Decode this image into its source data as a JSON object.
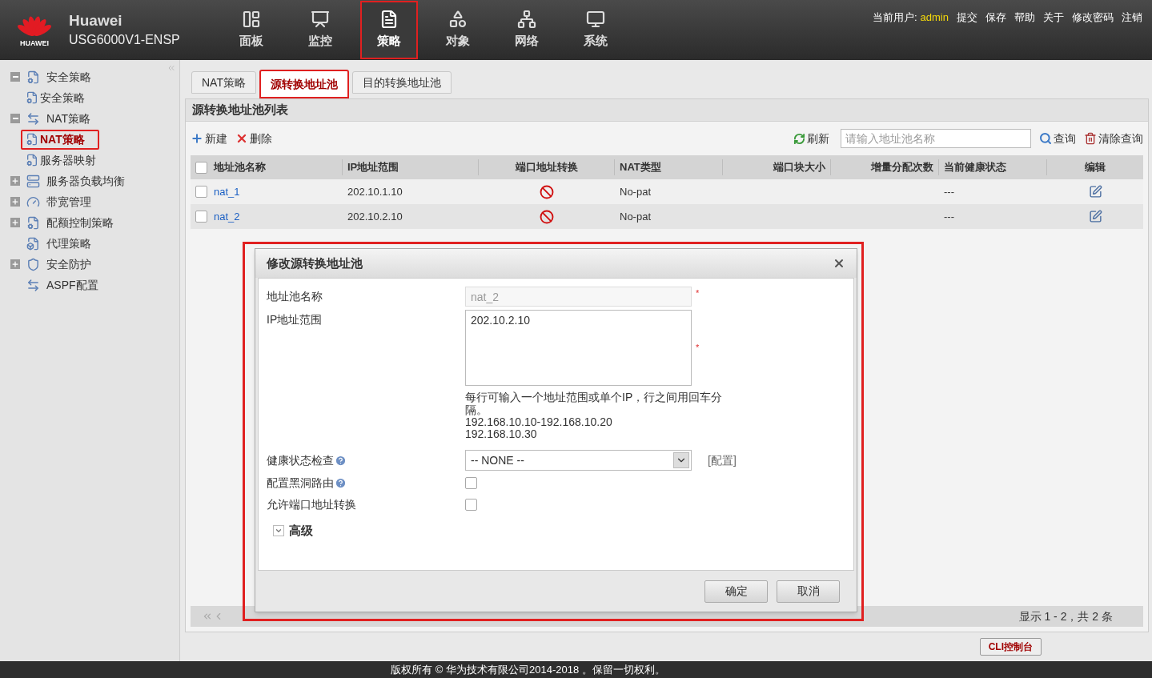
{
  "header": {
    "logo_text": "HUAWEI",
    "brand": "Huawei",
    "model": "USG6000V1-ENSP",
    "nav": [
      {
        "label": "面板",
        "selected": false
      },
      {
        "label": "监控",
        "selected": false
      },
      {
        "label": "策略",
        "selected": true
      },
      {
        "label": "对象",
        "selected": false
      },
      {
        "label": "网络",
        "selected": false
      },
      {
        "label": "系统",
        "selected": false
      }
    ],
    "user_label": "当前用户:",
    "user": "admin",
    "links": [
      "提交",
      "保存",
      "帮助",
      "关于",
      "修改密码",
      "注销"
    ]
  },
  "sidebar": {
    "items": [
      {
        "label": "安全策略",
        "kind": "folder",
        "expanded": true,
        "children": [
          {
            "label": "安全策略",
            "selected": false
          }
        ]
      },
      {
        "label": "NAT策略",
        "kind": "folder",
        "expanded": true,
        "children": [
          {
            "label": "NAT策略",
            "selected": true
          },
          {
            "label": "服务器映射",
            "selected": false
          }
        ]
      },
      {
        "label": "服务器负载均衡",
        "kind": "folder",
        "expanded": false
      },
      {
        "label": "带宽管理",
        "kind": "folder",
        "expanded": false
      },
      {
        "label": "配额控制策略",
        "kind": "folder",
        "expanded": false
      },
      {
        "label": "代理策略",
        "kind": "leaf"
      },
      {
        "label": "安全防护",
        "kind": "folder",
        "expanded": false
      },
      {
        "label": "ASPF配置",
        "kind": "leaf"
      }
    ]
  },
  "tabs": [
    {
      "label": "NAT策略",
      "selected": false
    },
    {
      "label": "源转换地址池",
      "selected": true
    },
    {
      "label": "目的转换地址池",
      "selected": false
    }
  ],
  "panel": {
    "title": "源转换地址池列表",
    "new": "新建",
    "delete": "删除",
    "refresh": "刷新",
    "search_placeholder": "请输入地址池名称",
    "query": "查询",
    "clear": "清除查询"
  },
  "table": {
    "all_checked": false,
    "columns": [
      "地址池名称",
      "IP地址范围",
      "端口地址转换",
      "NAT类型",
      "端口块大小",
      "增量分配次数",
      "当前健康状态",
      "编辑"
    ],
    "rows": [
      {
        "checked": false,
        "name": "nat_1",
        "ip": "202.10.1.10",
        "port_translation": false,
        "nat_type": "No-pat",
        "health": "---"
      },
      {
        "checked": false,
        "name": "nat_2",
        "ip": "202.10.2.10",
        "port_translation": false,
        "nat_type": "No-pat",
        "health": "---"
      }
    ]
  },
  "pagination": {
    "status": "显示 1 - 2，共 2 条"
  },
  "dialog": {
    "title": "修改源转换地址池",
    "name_label": "地址池名称",
    "name_value": "nat_2",
    "name_disabled": true,
    "ip_label": "IP地址范围",
    "ip_value": "202.10.2.10",
    "required_mark": "*",
    "hint": "每行可输入一个地址范围或单个IP，行之间用回车分隔。",
    "examples": [
      "192.168.10.10-192.168.10.20",
      "192.168.10.30"
    ],
    "health_label": "健康状态检查",
    "health_value": "-- NONE --",
    "config_link": "[配置]",
    "blackhole_label": "配置黑洞路由",
    "blackhole_checked": false,
    "port_label": "允许端口地址转换",
    "port_checked": false,
    "advanced_label": "高级",
    "advanced_expanded": false,
    "buttons": [
      "确定",
      "取消"
    ]
  },
  "cli_button": "CLI控制台",
  "footer": "版权所有 © 华为技术有限公司2014-2018 。保留一切权利。"
}
